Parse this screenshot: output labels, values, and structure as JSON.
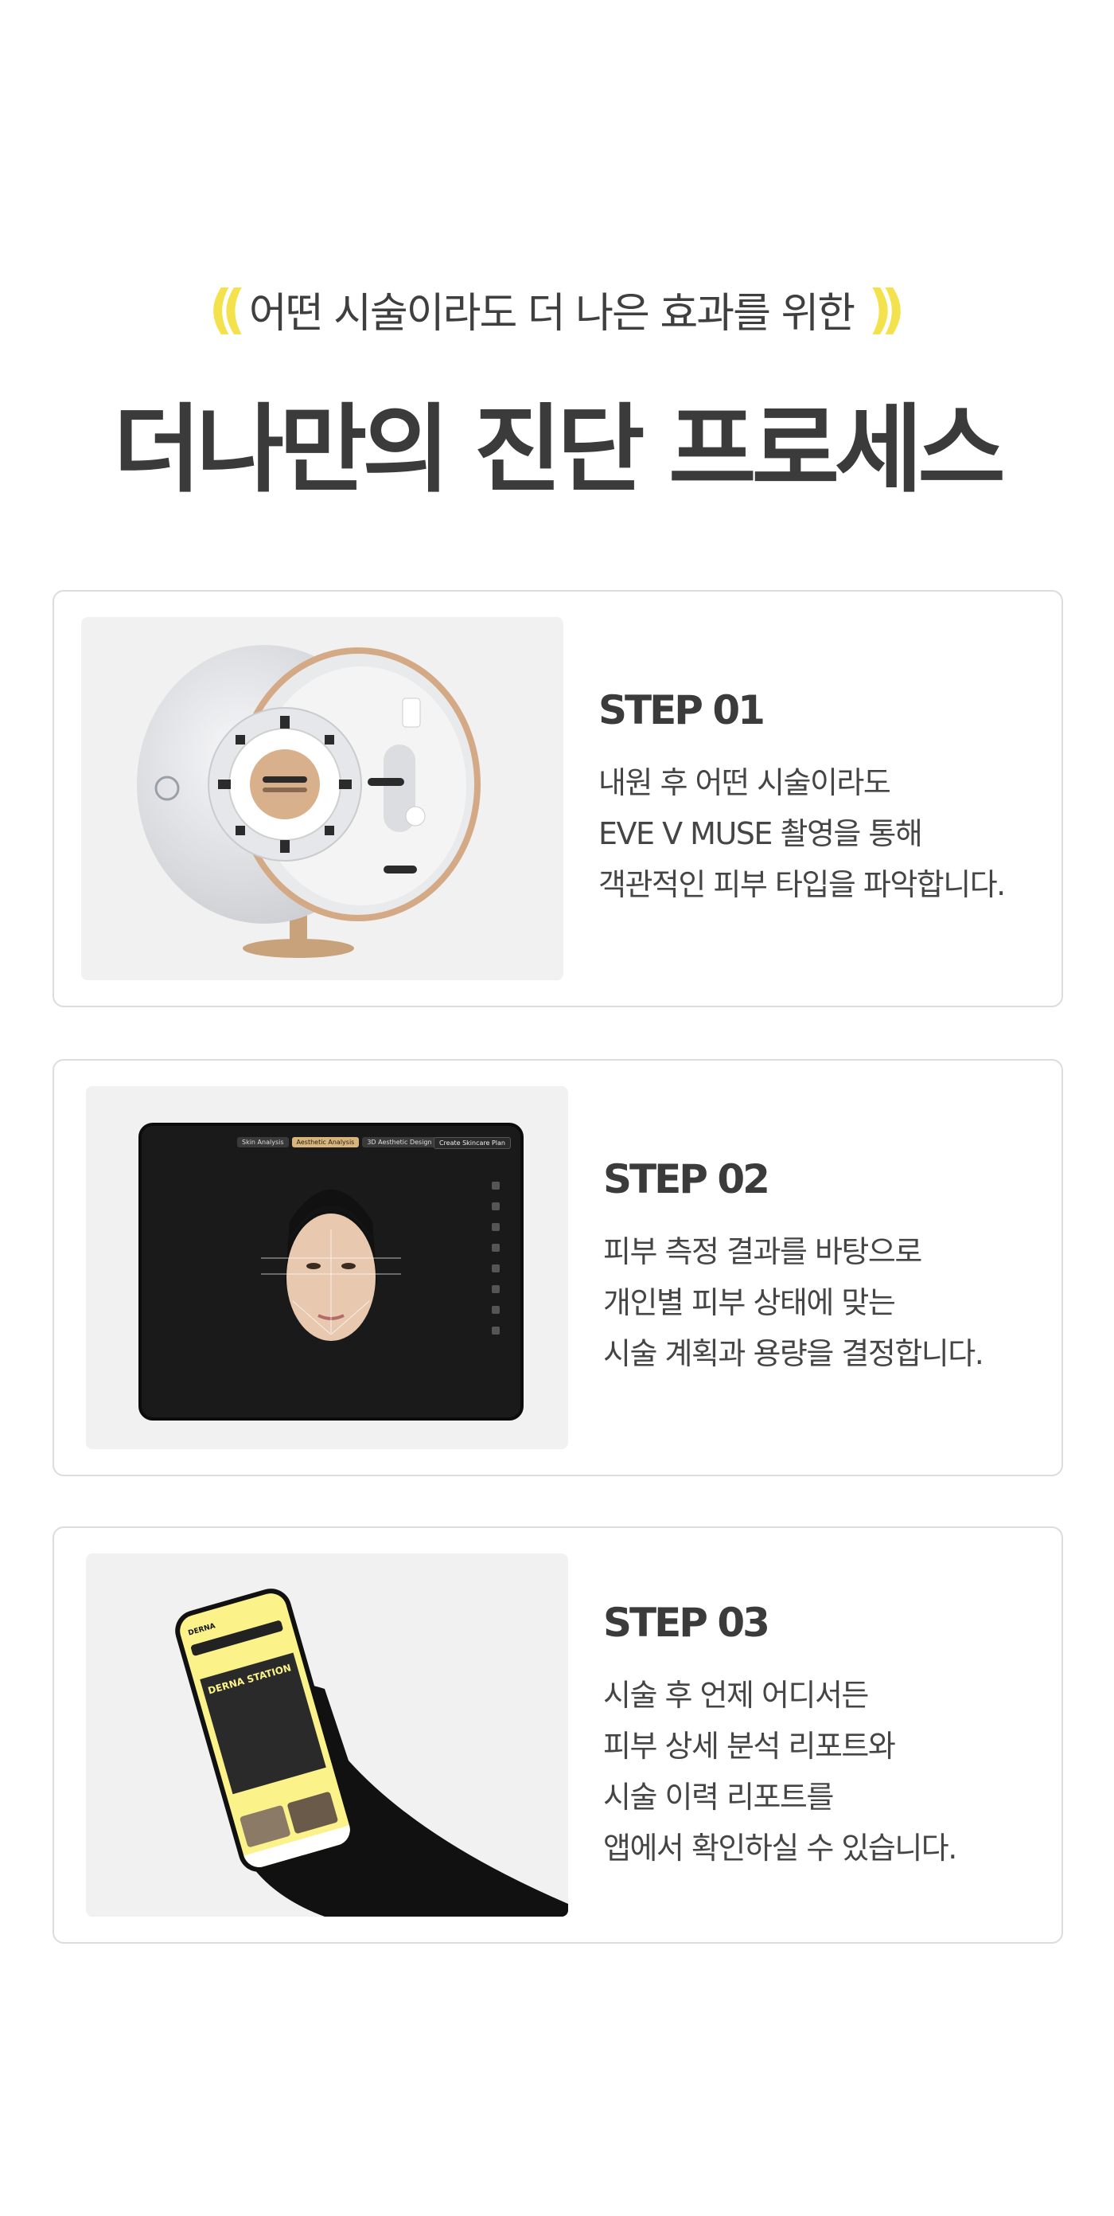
{
  "hero": {
    "paren_open": "((",
    "subtitle": "어떤 시술이라도 더 나은 효과를 위한",
    "paren_close": "))",
    "title": "더나만의 진단 프로세스"
  },
  "steps": [
    {
      "label": "STEP 01",
      "lines": [
        "내원 후 어떤 시술이라도",
        "EVE V MUSE 촬영을 통해",
        "객관적인 피부 타입을 파악합니다."
      ]
    },
    {
      "label": "STEP 02",
      "lines": [
        "피부 측정 결과를 바탕으로",
        "개인별 피부 상태에 맞는",
        "시술 계획과 용량을 결정합니다."
      ],
      "tablet": {
        "tabs": [
          "Skin Analysis",
          "Aesthetic Analysis",
          "3D Aesthetic Design"
        ],
        "create_button": "Create Skincare Plan"
      }
    },
    {
      "label": "STEP 03",
      "lines": [
        "시술 후 언제 어디서든",
        "피부 상세 분석 리포트와",
        "시술 이력 리포트를",
        "앱에서 확인하실 수 있습니다."
      ],
      "phone": {
        "app_name": "DERNA",
        "poster_title": "DERNA STATION"
      }
    }
  ],
  "colors": {
    "accent_yellow": "#f3e24c",
    "text_dark": "#3b3b3b",
    "card_border": "#dcdcdc",
    "media_bg": "#f1f1f1"
  }
}
